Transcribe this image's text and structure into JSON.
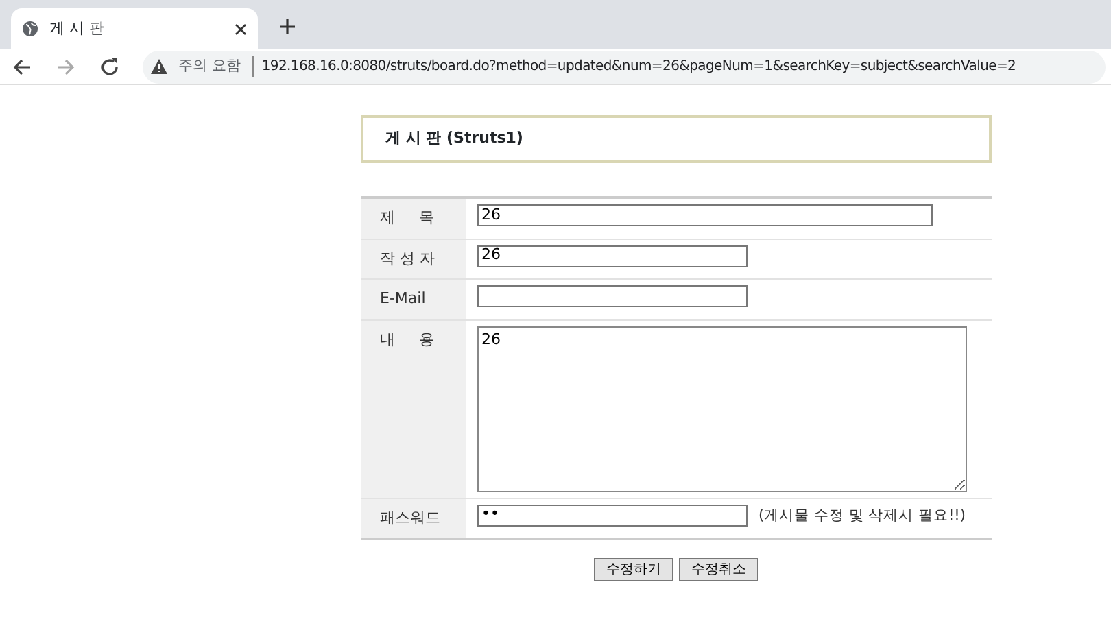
{
  "browser": {
    "tab": {
      "title": "게 시 판",
      "selected": true
    },
    "security_label": "주의 요함",
    "url": "192.168.16.0:8080/struts/board.do?method=updated&num=26&pageNum=1&searchKey=subject&searchValue=2"
  },
  "board_title": "게 시 판 (Struts1)",
  "form": {
    "rows": [
      {
        "kind": "input",
        "label": "제     목",
        "value": "26",
        "wide": true
      },
      {
        "kind": "input",
        "label": "작 성 자",
        "value": "26",
        "wide": false
      },
      {
        "kind": "input",
        "label": "E-Mail",
        "value": "",
        "wide": false
      },
      {
        "kind": "textarea",
        "label": "내     용",
        "value": "26"
      },
      {
        "kind": "input",
        "label": "패스워드",
        "value": "••",
        "wide": false,
        "note": "(게시물 수정 및 삭제시 필요!!)"
      }
    ]
  },
  "buttons": [
    "수정하기",
    "수정취소"
  ]
}
